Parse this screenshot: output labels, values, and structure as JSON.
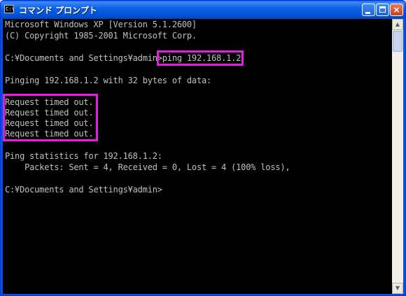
{
  "window": {
    "title": "コマンド プロンプト",
    "icon": "console-icon",
    "icon_label": "C:\\",
    "buttons": {
      "minimize": "_",
      "maximize": "□",
      "close": "×"
    }
  },
  "console": {
    "lines": [
      "Microsoft Windows XP [Version 5.1.2600]",
      "(C) Copyright 1985-2001 Microsoft Corp.",
      "",
      "C:¥Documents and Settings¥admin>ping 192.168.1.2",
      "",
      "Pinging 192.168.1.2 with 32 bytes of data:",
      "",
      "Request timed out.",
      "Request timed out.",
      "Request timed out.",
      "Request timed out.",
      "",
      "Ping statistics for 192.168.1.2:",
      "    Packets: Sent = 4, Received = 0, Lost = 4 (100% loss),",
      "",
      "C:¥Documents and Settings¥admin>"
    ],
    "highlight_color": "#e21ee2",
    "text_color": "#c0c0c0",
    "background": "#000000"
  },
  "scrollbar": {
    "up_arrow": "▲",
    "down_arrow": "▼"
  }
}
